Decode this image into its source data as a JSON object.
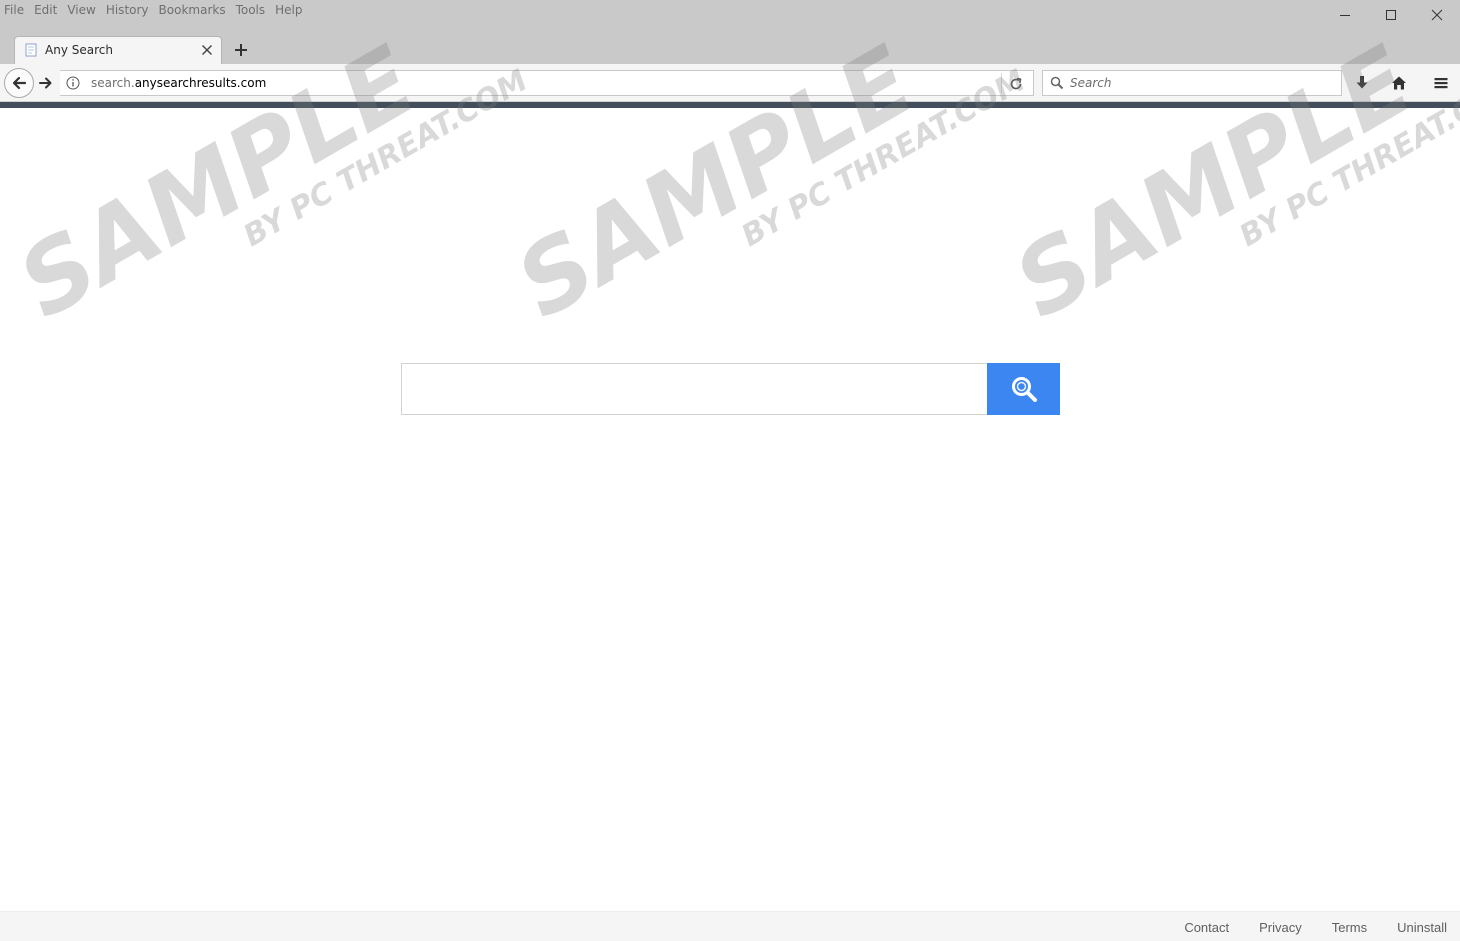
{
  "menu": {
    "items": [
      "File",
      "Edit",
      "View",
      "History",
      "Bookmarks",
      "Tools",
      "Help"
    ]
  },
  "tab": {
    "title": "Any Search"
  },
  "navbar": {
    "url_prefix": "search.",
    "url_domain": "anysearchresults.com",
    "search_placeholder": "Search"
  },
  "footer": {
    "links": [
      "Contact",
      "Privacy",
      "Terms",
      "Uninstall"
    ]
  },
  "watermark": {
    "main_text": "SAMPLE",
    "sub_text": "BY PC THREAT.COM"
  },
  "colors": {
    "search_button": "#3b86f0",
    "accent_line": "#434e5c",
    "chrome_bg": "#c9c9c9"
  }
}
